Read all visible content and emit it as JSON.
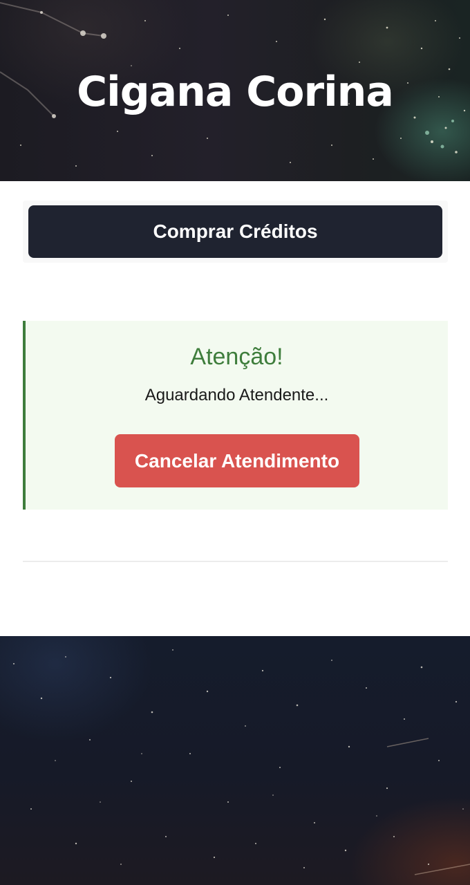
{
  "header": {
    "title": "Cigana Corina"
  },
  "toolbar": {
    "buy_credits_label": "Comprar Créditos"
  },
  "alert": {
    "title": "Atenção!",
    "message": "Aguardando Atendente...",
    "cancel_label": "Cancelar Atendimento"
  },
  "colors": {
    "primary_button": "#1f2330",
    "alert_accent": "#3e7d3c",
    "alert_background": "#f3faf0",
    "danger_button": "#d9534f"
  }
}
